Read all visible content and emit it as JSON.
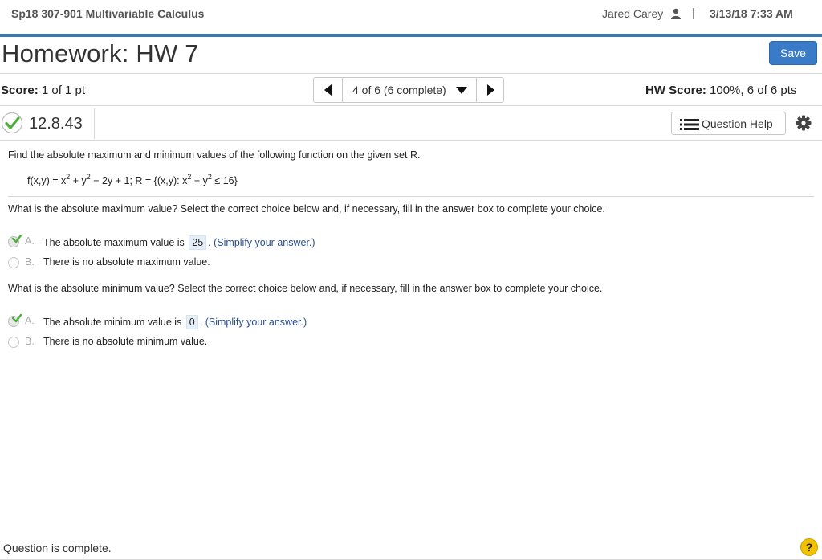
{
  "header": {
    "course": "Sp18 307-901 Multivariable Calculus",
    "user": "Jared Carey",
    "separator": "|",
    "datetime": "3/13/18 7:33 AM"
  },
  "homework": {
    "title": "Homework: HW 7",
    "save_label": "Save"
  },
  "score": {
    "label": "Score:",
    "value": "1 of 1 pt"
  },
  "navigator": {
    "position": "4 of 6 (6 complete)"
  },
  "hw_score": {
    "label": "HW Score:",
    "value": "100%, 6 of 6 pts"
  },
  "question": {
    "number": "12.8.43",
    "help_label": "Question Help",
    "prompt": "Find the absolute maximum and minimum values of the following function on the given set R.",
    "formula": {
      "f1": "f(x,y) = x",
      "e1": "2",
      "f2": " + y",
      "e2": "2",
      "f3": " − 2y + 1; R = {(x,y): x",
      "e3": "2",
      "f4": " + y",
      "e4": "2",
      "f5": " ≤ 16}"
    },
    "parts": [
      {
        "text": "What is the absolute maximum value? Select the correct choice below and, if necessary, fill in the answer box to complete your choice.",
        "choices": [
          {
            "letter": "A.",
            "prefix": "The absolute maximum value is",
            "answer": "25",
            "suffix": ".",
            "hint": "(Simplify your answer.)"
          },
          {
            "letter": "B.",
            "text": "There is no absolute maximum value."
          }
        ]
      },
      {
        "text": "What is the absolute minimum value? Select the correct choice below and, if necessary, fill in the answer box to complete your choice.",
        "choices": [
          {
            "letter": "A.",
            "prefix": "The absolute minimum value is",
            "answer": "0",
            "suffix": ".",
            "hint": "(Simplify your answer.)"
          },
          {
            "letter": "B.",
            "text": "There is no absolute minimum value."
          }
        ]
      }
    ]
  },
  "footer": {
    "status": "Question is complete.",
    "help_glyph": "?"
  },
  "colors": {
    "accent": "#3a7ca5",
    "save_button": "#3a7bc8",
    "correct_green": "#4caf3a",
    "hint_blue": "#2a4d8f",
    "help_yellow": "#f2c200"
  },
  "icons": [
    "user-icon",
    "check-icon",
    "list-icon",
    "gear-icon",
    "help-icon",
    "chevron-left-icon",
    "chevron-right-icon",
    "caret-down-icon"
  ]
}
